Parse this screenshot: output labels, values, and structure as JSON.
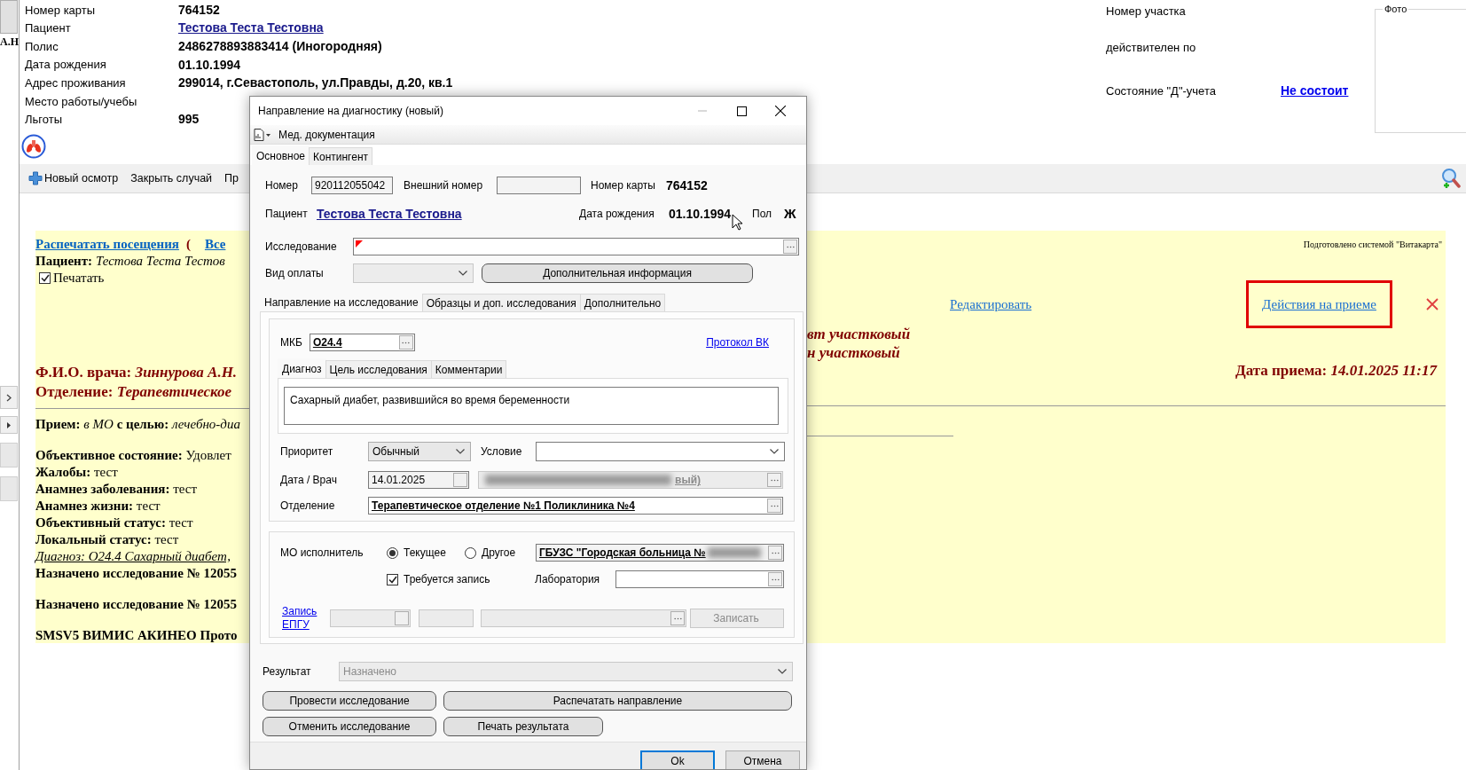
{
  "side_panel": {
    "label": "А.Н"
  },
  "patient_card": {
    "fields": [
      {
        "label": "Номер карты",
        "value": "764152",
        "kind": "text"
      },
      {
        "label": "Пациент",
        "value": "Тестова Теста Тестовна",
        "kind": "link"
      },
      {
        "label": "Полис",
        "value": "2486278893883414 (Иногородняя)",
        "kind": "text"
      },
      {
        "label": "Дата рождения",
        "value": "01.10.1994",
        "kind": "text"
      },
      {
        "label": "Адрес проживания",
        "value": "299014, г.Севастополь, ул.Правды, д.20, кв.1",
        "kind": "text"
      },
      {
        "label": "Место работы/учебы"
      },
      {
        "label": "Льготы",
        "value": "995",
        "kind": "text"
      }
    ],
    "district_fields": [
      {
        "label": "Номер участка"
      },
      {
        "label": "действителен по"
      },
      {
        "label": "Состояние \"Д\"-учета",
        "value": "Не состоит"
      }
    ],
    "photo": {
      "legend": "Фото"
    }
  },
  "toolbar": [
    {
      "label": "Новый осмотр",
      "kind": "add"
    },
    {
      "label": "Закрыть случай",
      "kind": "plain"
    },
    {
      "label": "Пр",
      "kind": "plain"
    }
  ],
  "visit_report": {
    "print_link": "Распечатать посещения",
    "bracket": "(",
    "all_link": "Все",
    "patient": "**Пациент:** *Тестова Теста Тестов*",
    "print_checkbox": {
      "label": "Печатать",
      "checked": true
    },
    "system_note": "Подготовлено системой \"Витакарта\"",
    "edit_link": "Редактировать",
    "actions_link": {
      "label": "Действия на приеме",
      "highlighted": true
    },
    "doctor": "Ф.И.О. врача: *Зиннурова А.Н.*",
    "department": "Отделение: *Терапевтическое*",
    "position_lines": [
      "вт участковый",
      "н участковый"
    ],
    "visit_date": "Дата приема: *14.01.2025 11:17*",
    "paragraphs": [
      [
        {
          "kind": "text",
          "text": "**Прием:** *в МО* **с целью:** *лечебно-диа*"
        }
      ],
      [
        {
          "kind": "text",
          "text": "**Объективное состояние:** Удовлет"
        },
        {
          "kind": "text",
          "text": "**Жалобы:** тест"
        },
        {
          "kind": "text",
          "text": "**Анамнез заболевания:** тест"
        },
        {
          "kind": "text",
          "text": "**Анамнез жизни:** тест"
        },
        {
          "kind": "text",
          "text": "**Объективный статус:** тест"
        },
        {
          "kind": "text",
          "text": "**Локальный статус:** тест"
        },
        {
          "kind": "diagnosis",
          "text": "Диагноз: O24.4 Сахарный диабет,"
        },
        {
          "kind": "heading",
          "text": "Назначено исследование № 12055"
        }
      ],
      [
        {
          "kind": "heading",
          "text": "Назначено исследование № 12055"
        }
      ],
      [
        {
          "kind": "heading",
          "text": "SMSV5 ВИМИС АКИНЕО Прото"
        }
      ]
    ]
  },
  "dialog": {
    "title": "Направление на диагностику (новый)",
    "minimize_disabled": true,
    "menu": "Мед. документация",
    "tabs": [
      {
        "label": "Основное",
        "selected": true
      },
      {
        "label": "Контингент",
        "selected": false
      }
    ],
    "header": {
      "number_label": "Номер",
      "number": "920112055042",
      "external_label": "Внешний номер",
      "card_label": "Номер карты",
      "card": "764152",
      "patient_label": "Пациент",
      "patient": "Тестова Теста Тестовна",
      "birth_label": "Дата рождения",
      "birth": "01.10.1994",
      "sex_label": "Пол",
      "sex": "Ж"
    },
    "study": {
      "label": "Исследование",
      "required": true
    },
    "payment": {
      "label": "Вид оплаты",
      "disabled": true
    },
    "more_info_button": "Дополнительная информация",
    "inner_tabs": [
      {
        "label": "Направление на исследование",
        "selected": true
      },
      {
        "label": "Образцы и доп. исследования",
        "selected": false
      },
      {
        "label": "Дополнительно",
        "selected": false
      }
    ],
    "mkb": {
      "label": "МКБ",
      "value": "O24.4"
    },
    "protocol_link": "Протокол ВК",
    "sub_tabs": [
      {
        "label": "Диагноз",
        "selected": true
      },
      {
        "label": "Цель исследования",
        "selected": false
      },
      {
        "label": "Комментарии",
        "selected": false
      }
    ],
    "diagnosis_text": "Сахарный диабет, развившийся во время беременности",
    "priority": {
      "label": "Приоритет",
      "value": "Обычный"
    },
    "condition": {
      "label": "Условие"
    },
    "date_doctor": {
      "label": "Дата / Врач",
      "date": "14.01.2025",
      "doctor": "вый)",
      "doctor_disabled": true
    },
    "department": {
      "label": "Отделение",
      "value": "Терапевтическое отделение №1 Поликлиника №4"
    },
    "executor": {
      "label": "МО исполнитель",
      "options": [
        {
          "label": "Текущее",
          "selected": true
        },
        {
          "label": "Другое",
          "selected": false
        }
      ],
      "organization": "ГБУЗС \"Городская больница №"
    },
    "booking_required": {
      "label": "Требуется запись",
      "checked": true
    },
    "lab": {
      "label": "Лаборатория"
    },
    "epgu": {
      "link": "Запись ЕПГУ",
      "button": "Записать",
      "disabled": true
    },
    "result": {
      "label": "Результат",
      "value": "Назначено",
      "disabled": true
    },
    "actions": [
      "Провести исследование",
      "Распечатать направление",
      "Отменить исследование",
      "Печать результата"
    ],
    "footer": [
      {
        "label": "Ok",
        "default": true
      },
      {
        "label": "Отмена",
        "default": false
      }
    ]
  }
}
